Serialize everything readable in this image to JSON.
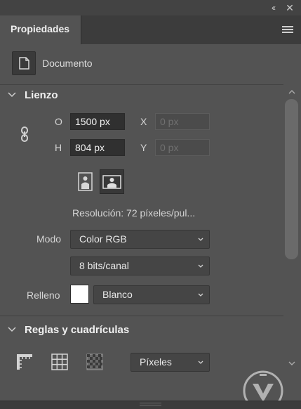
{
  "window": {
    "collapse_glyph": "‹‹",
    "close_glyph": "✕"
  },
  "tabs": [
    {
      "label": "Propiedades",
      "active": true
    }
  ],
  "document": {
    "label": "Documento"
  },
  "canvas_section": {
    "title": "Lienzo",
    "width_label": "O",
    "width_value": "1500 px",
    "height_label": "H",
    "height_value": "804 px",
    "x_label": "X",
    "x_placeholder": "0 px",
    "y_label": "Y",
    "y_placeholder": "0 px",
    "resolution": "Resolución:  72  píxeles/pul...",
    "mode_label": "Modo",
    "mode_value": "Color RGB",
    "depth_value": "8 bits/canal",
    "fill_label": "Relleno",
    "fill_value": "Blanco",
    "fill_color": "#ffffff"
  },
  "rulers_section": {
    "title": "Reglas y cuadrículas",
    "units_value": "Píxeles"
  },
  "colors": {
    "panel": "#535353",
    "field": "#303030",
    "accent_text": "#f0f0f0"
  }
}
